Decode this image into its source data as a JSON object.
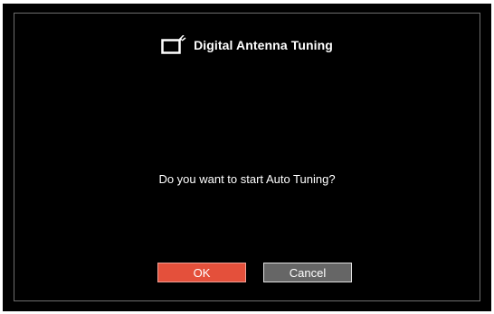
{
  "dialog": {
    "title": "Digital Antenna Tuning",
    "icon": "tv-antenna-icon",
    "message": "Do you want to start Auto Tuning?"
  },
  "buttons": {
    "ok_label": "OK",
    "cancel_label": "Cancel"
  },
  "colors": {
    "background": "#000000",
    "ok_button": "#e4503b",
    "cancel_button": "#666666",
    "text": "#ffffff"
  }
}
